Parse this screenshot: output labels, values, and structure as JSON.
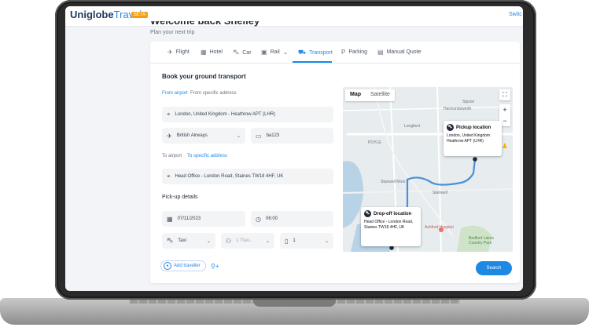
{
  "header": {
    "logo_main": "Uniglobe",
    "logo_accent": "Travel",
    "beta": "BETA",
    "switch": "Switc",
    "welcome": "Welcome back Shelley",
    "subtitle": "Plan your next trip"
  },
  "tabs": [
    {
      "label": "Flight",
      "icon": "plane-icon"
    },
    {
      "label": "Hotel",
      "icon": "hotel-icon"
    },
    {
      "label": "Car",
      "icon": "car-icon"
    },
    {
      "label": "Rail",
      "icon": "train-icon"
    },
    {
      "label": "Transport",
      "icon": "bus-icon"
    },
    {
      "label": "Parking",
      "icon": "parking-icon"
    },
    {
      "label": "Manual Quote",
      "icon": "document-icon"
    }
  ],
  "active_tab": "Transport",
  "form": {
    "title": "Book your ground transport",
    "from_options": [
      "From airport",
      "From specific address"
    ],
    "from_selected": "From airport",
    "from_value": "London, United Kingdom - Heathrow APT (LHR)",
    "airline": "British Airways",
    "flight_number": "ba123",
    "to_options": [
      "To airport",
      "To specific address"
    ],
    "to_selected": "To specific address",
    "to_value": "Head Office - London Road, Staines TW18 4HF, UK",
    "pickup_label": "Pick-up details",
    "date": "07/11/2023",
    "time": "06:00",
    "vehicle": "Taxi",
    "travellers_placeholder": "1 Trav...",
    "luggage": "1",
    "add_traveller": "Add traveller",
    "search": "Search"
  },
  "map": {
    "tabs": [
      "Map",
      "Satellite"
    ],
    "selected_tab": "Map",
    "labels": [
      "Harmondsworth",
      "Sipson",
      "Longford",
      "POYLE",
      "Stanwell Moor",
      "Stanwell",
      "Bedfont Lakes Country Park",
      "Ashford Hospital"
    ],
    "pickup_title": "Pickup location",
    "pickup_address": "London, United Kingdom Heathrow APT (LHR)",
    "dropoff_title": "Drop-off location",
    "dropoff_address": "Head Office - London Road, Staines TW18 4HF, UK",
    "route_color": "#4a90d9"
  },
  "colors": {
    "accent": "#1e88e5",
    "brand_dark": "#1e3a5f",
    "beta": "#f59e0b"
  }
}
